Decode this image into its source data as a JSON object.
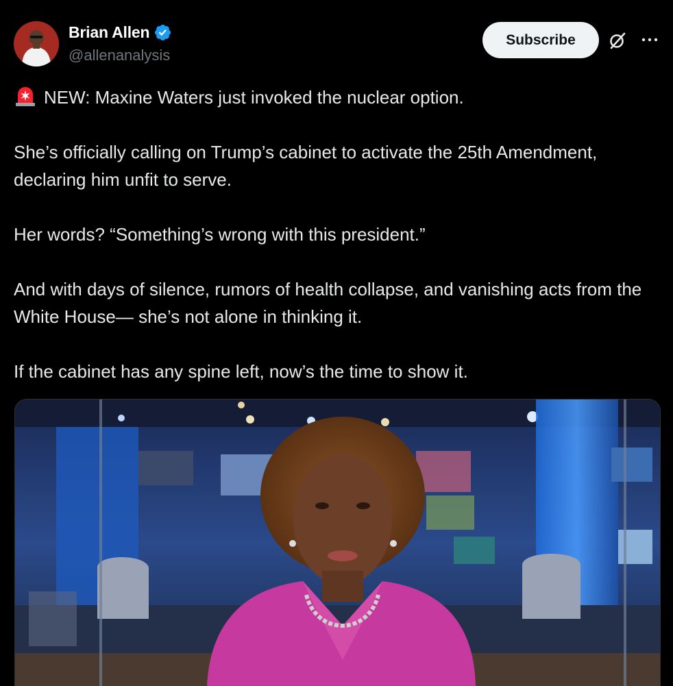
{
  "author": {
    "display_name": "Brian Allen",
    "handle": "@allenanalysis",
    "verified": true,
    "avatar_icon": "avatar-photo"
  },
  "header": {
    "subscribe_label": "Subscribe",
    "grok_icon": "grok-icon",
    "more_icon": "more-options-icon"
  },
  "post": {
    "paragraphs": [
      "NEW: Maxine Waters just invoked the nuclear option.",
      "She’s officially calling on Trump’s cabinet to activate the 25th Amendment, declaring him unfit to serve.",
      "Her words? “Something’s wrong with this president.”",
      "And with days of silence, rumors of health collapse, and vanishing acts from the White House— she’s not alone in thinking it.",
      "If the cabinet has any spine left, now’s the time to show it."
    ],
    "leading_emoji": "rotating-light-icon"
  },
  "media": {
    "type": "video-still",
    "description_icon": "news-studio-video"
  },
  "colors": {
    "background": "#000000",
    "text": "#e7e9ea",
    "secondary_text": "#71767b",
    "verified_blue": "#1d9bf0",
    "subscribe_bg": "#eff3f4",
    "siren_red": "#f4212e"
  }
}
